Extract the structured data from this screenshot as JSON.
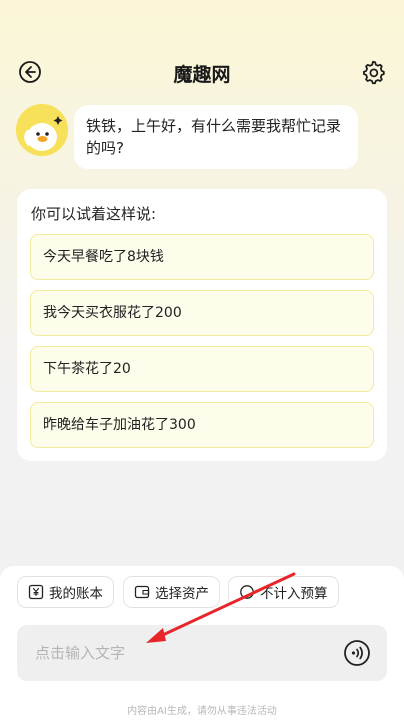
{
  "header": {
    "title": "魔趣网"
  },
  "greeting": {
    "text": "铁铁，上午好，有什么需要我帮忙记录的吗?"
  },
  "suggestions": {
    "title": "你可以试着这样说:",
    "items": [
      "今天早餐吃了8块钱",
      "我今天买衣服花了200",
      "下午茶花了20",
      "昨晚给车子加油花了300"
    ]
  },
  "chips": {
    "account": "我的账本",
    "assets": "选择资产",
    "budget": "不计入预算"
  },
  "input": {
    "placeholder": "点击输入文字"
  },
  "footer": {
    "disclaimer": "内容由AI生成，请勿从事违法活动"
  },
  "colors": {
    "accent_yellow": "#f7e05a",
    "item_border": "#f3ea9f",
    "item_bg": "#fefcea",
    "arrow_red": "#e8252a"
  }
}
